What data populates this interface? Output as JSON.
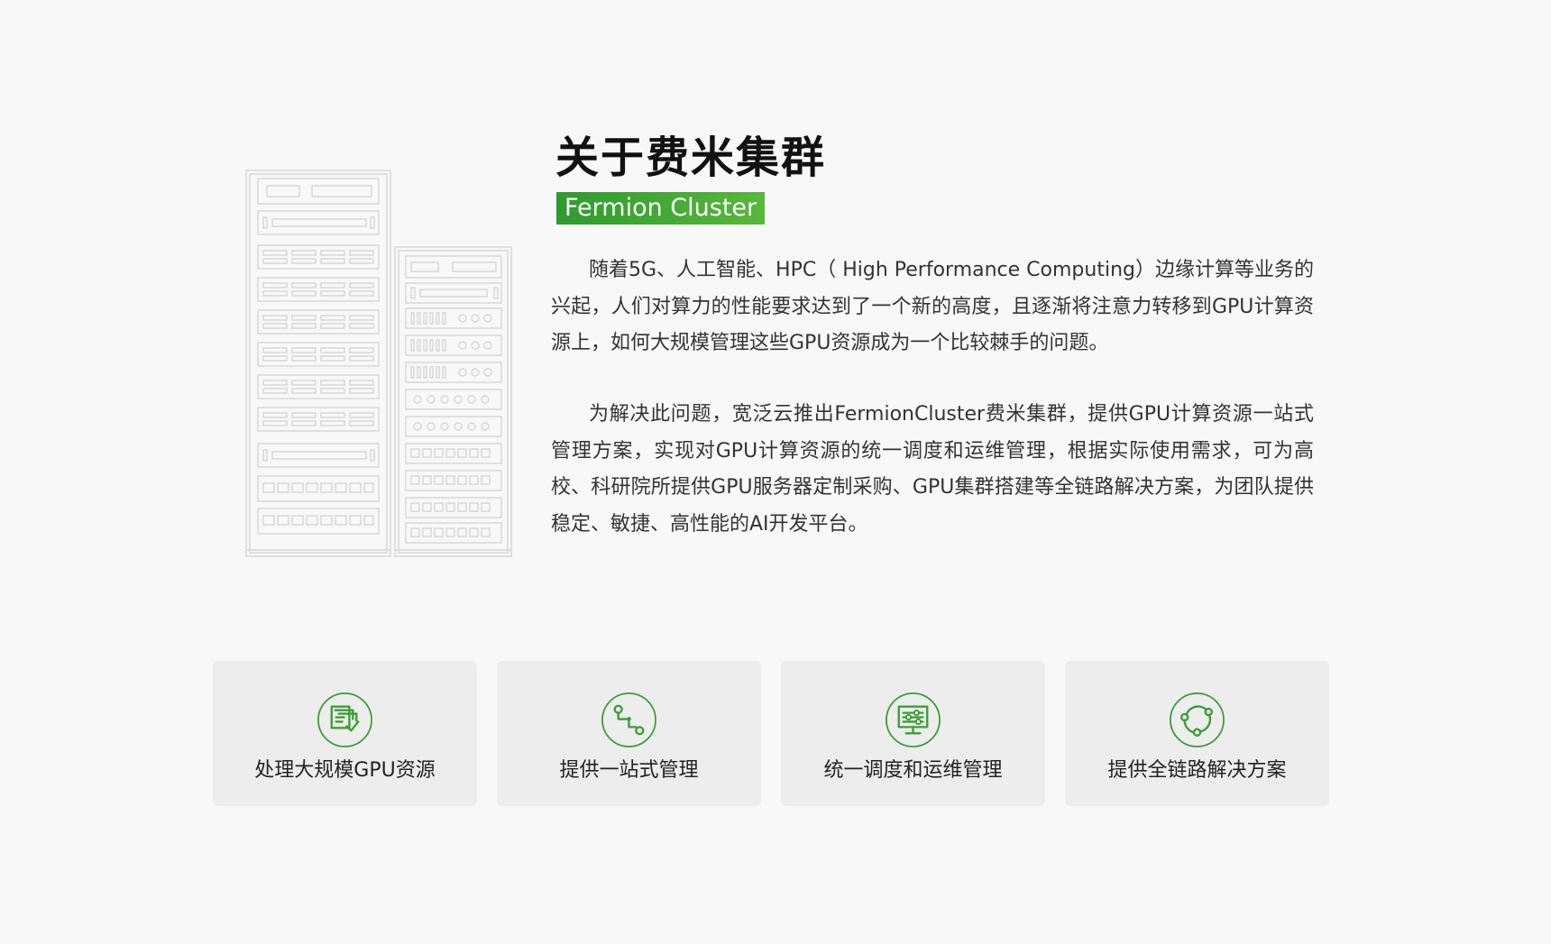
{
  "header": {
    "title": "关于费米集群",
    "subtitle": "Fermion Cluster"
  },
  "intro": {
    "paragraph_1": "随着5G、人工智能、HPC（ High Performance Computing）边缘计算等业务的兴起，人们对算力的性能要求达到了一个新的高度，且逐渐将注意力转移到GPU计算资源上，如何大规模管理这些GPU资源成为一个比较棘手的问题。",
    "paragraph_2": "为解决此问题，宽泛云推出FermionCluster费米集群，提供GPU计算资源一站式管理方案，实现对GPU计算资源的统一调度和运维管理，根据实际使用需求，可为高校、科研院所提供GPU服务器定制采购、GPU集群搭建等全链路解决方案，为团队提供稳定、敏捷、高性能的AI开发平台。"
  },
  "features": [
    {
      "label": "处理大规模GPU资源",
      "icon": "gpu-resource-icon"
    },
    {
      "label": "提供一站式管理",
      "icon": "workflow-icon"
    },
    {
      "label": "统一调度和运维管理",
      "icon": "monitor-settings-icon"
    },
    {
      "label": "提供全链路解决方案",
      "icon": "cycle-icon"
    }
  ],
  "colors": {
    "accent": "#3a9e34",
    "accent_light": "#5cb83c",
    "card_bg": "#ededed",
    "page_bg": "#f8f8f8"
  }
}
